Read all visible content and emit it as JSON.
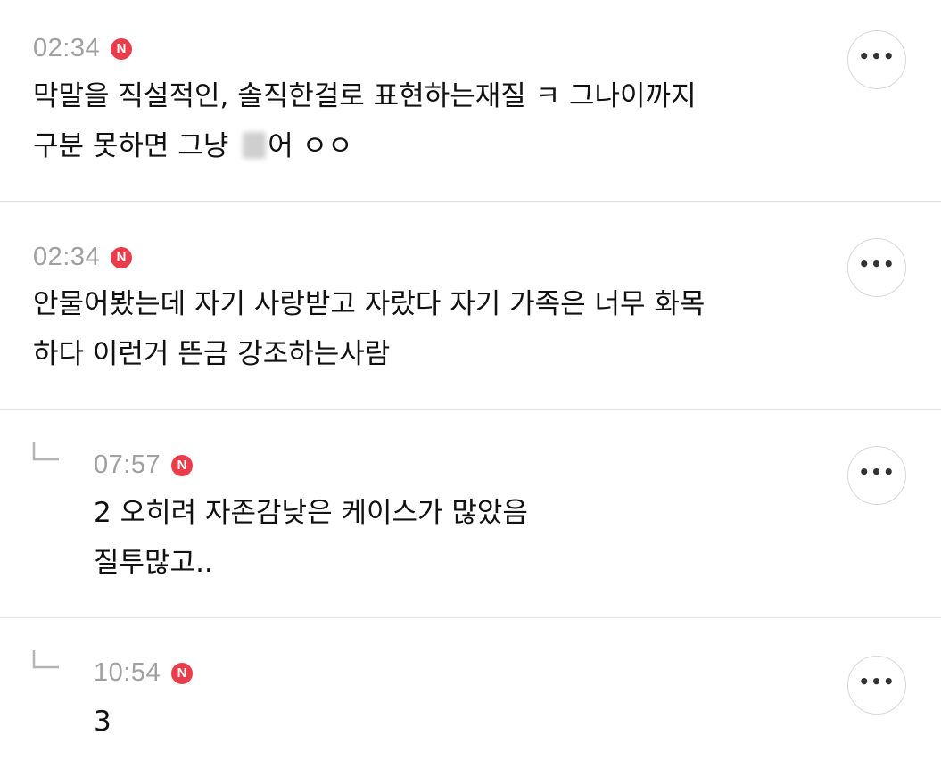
{
  "comments": [
    {
      "time": "02:34",
      "badge": "N",
      "line1": "막말을 직설적인, 솔직한걸로 표현하는재질 ㅋ 그나이까지",
      "line2_before": "구분 못하면 그냥 ",
      "line2_after": "어 ㅇㅇ",
      "more": "•••"
    },
    {
      "time": "02:34",
      "badge": "N",
      "line1": "안물어봤는데 자기 사랑받고 자랐다 자기 가족은 너무 화목",
      "line2": "하다 이런거 뜬금 강조하는사람",
      "more": "•••"
    },
    {
      "time": "07:57",
      "badge": "N",
      "line1": "2 오히려 자존감낮은 케이스가 많았음",
      "line2": "질투많고..",
      "more": "•••",
      "is_reply": true
    },
    {
      "time": "10:54",
      "badge": "N",
      "line1": "3",
      "more": "•••",
      "is_reply": true
    }
  ],
  "colors": {
    "badge": "#ea3d4b",
    "time": "#a0a0a0",
    "text": "#111111",
    "divider": "#e4e4e4"
  },
  "icons": {
    "reply": "reply-arrow-icon",
    "more": "more-options-icon",
    "new_badge": "new-badge-icon"
  }
}
